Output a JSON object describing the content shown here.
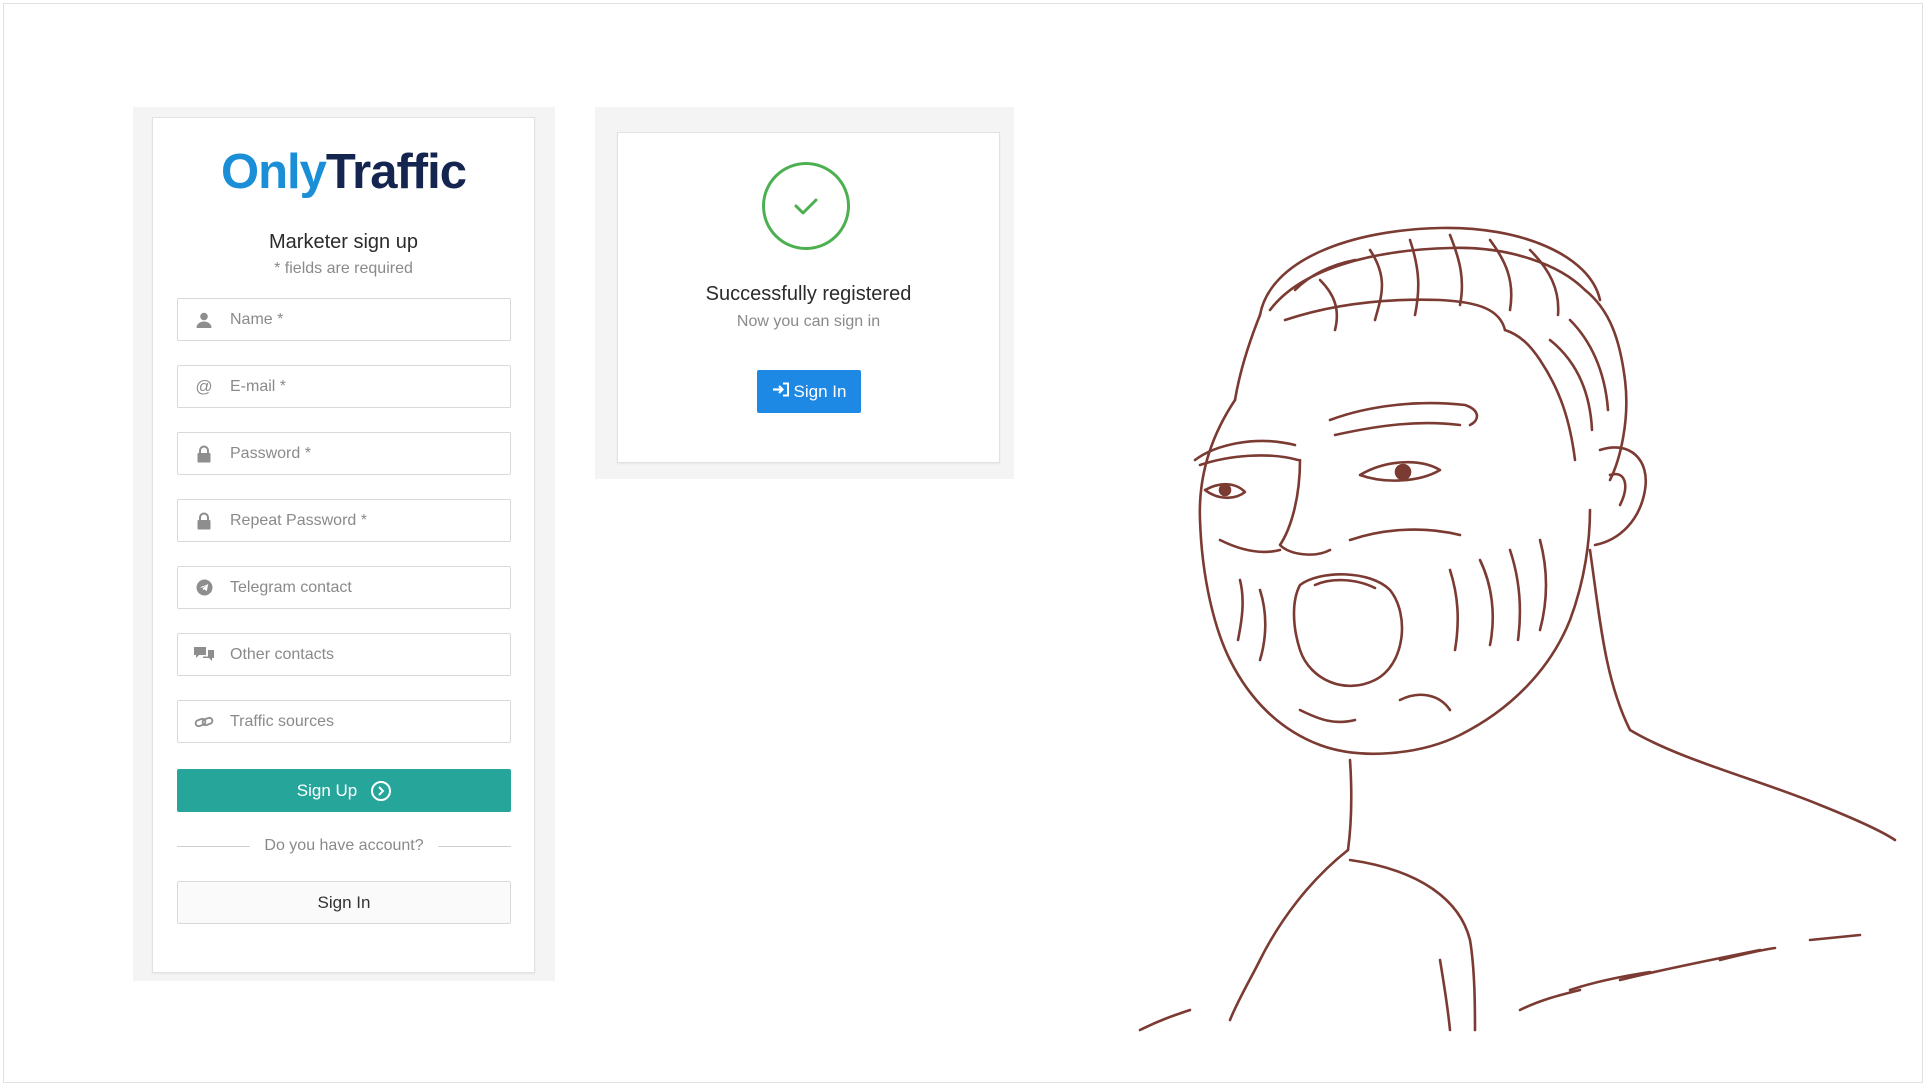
{
  "signup": {
    "logo": {
      "part1": "Only",
      "part2": "Traffic"
    },
    "title": "Marketer sign up",
    "subtitle": "* fields are required",
    "fields": [
      {
        "icon": "user-icon",
        "placeholder": "Name *"
      },
      {
        "icon": "at-icon",
        "placeholder": "E-mail *"
      },
      {
        "icon": "lock-icon",
        "placeholder": "Password *"
      },
      {
        "icon": "lock-icon",
        "placeholder": "Repeat Password *"
      },
      {
        "icon": "telegram-icon",
        "placeholder": "Telegram contact"
      },
      {
        "icon": "chat-icon",
        "placeholder": "Other contacts"
      },
      {
        "icon": "link-icon",
        "placeholder": "Traffic sources"
      }
    ],
    "signup_button": "Sign Up",
    "divider_text": "Do you have account?",
    "signin_button": "Sign In"
  },
  "success": {
    "title": "Successfully registered",
    "subtitle": "Now you can sign in",
    "signin_button": "Sign In"
  },
  "colors": {
    "brand_blue": "#1a8fd8",
    "brand_navy": "#14254f",
    "teal": "#26a69a",
    "primary": "#1e88e5",
    "success_green": "#4caf50",
    "sketch_stroke": "#7b3a32"
  }
}
